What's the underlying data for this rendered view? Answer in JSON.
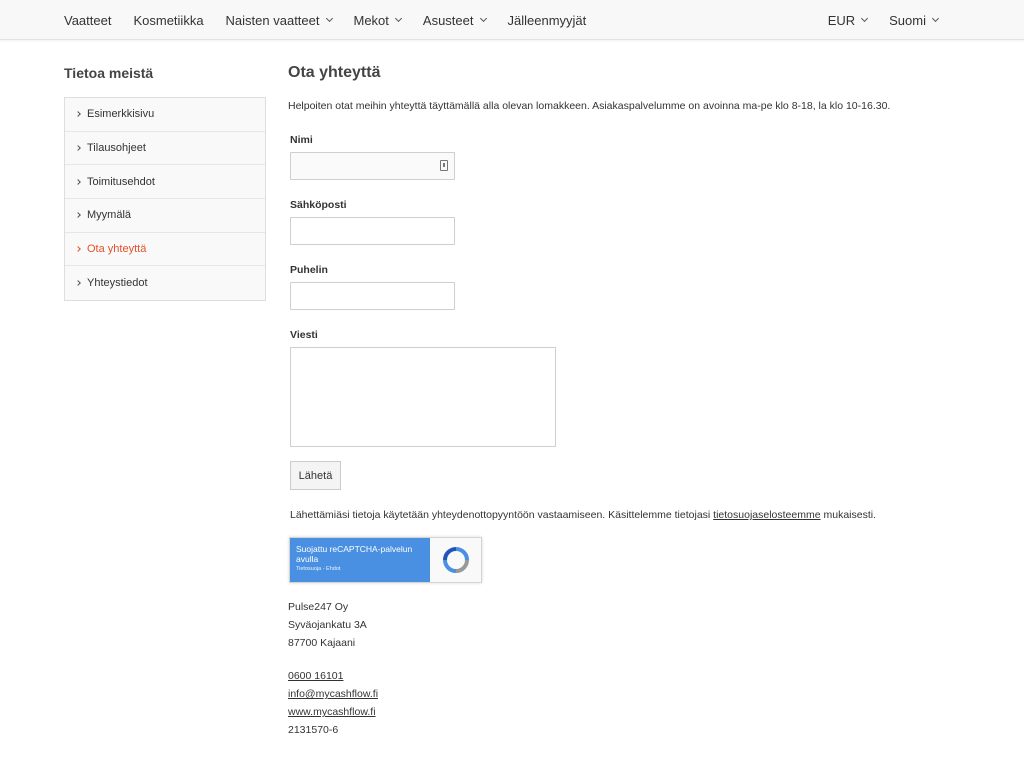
{
  "nav": {
    "left": [
      {
        "label": "Vaatteet",
        "dropdown": false
      },
      {
        "label": "Kosmetiikka",
        "dropdown": false
      },
      {
        "label": "Naisten vaatteet",
        "dropdown": true
      },
      {
        "label": "Mekot",
        "dropdown": true
      },
      {
        "label": "Asusteet",
        "dropdown": true
      },
      {
        "label": "Jälleenmyyjät",
        "dropdown": false
      }
    ],
    "currency": "EUR",
    "language": "Suomi"
  },
  "sidebar": {
    "title": "Tietoa meistä",
    "items": [
      {
        "label": "Esimerkkisivu",
        "active": false
      },
      {
        "label": "Tilausohjeet",
        "active": false
      },
      {
        "label": "Toimitusehdot",
        "active": false
      },
      {
        "label": "Myymälä",
        "active": false
      },
      {
        "label": "Ota yhteyttä",
        "active": true
      },
      {
        "label": "Yhteystiedot",
        "active": false
      }
    ]
  },
  "main": {
    "title": "Ota yhteyttä",
    "intro": "Helpoiten otat meihin yhteyttä täyttämällä alla olevan lomakkeen. Asiakaspalvelumme on avoinna ma-pe klo 8-18, la klo 10-16.30.",
    "form": {
      "name_label": "Nimi",
      "name_value": "",
      "email_label": "Sähköposti",
      "email_value": "",
      "phone_label": "Puhelin",
      "phone_value": "",
      "message_label": "Viesti",
      "message_value": "",
      "submit_label": "Lähetä"
    },
    "privacy": {
      "before": "Lähettämiäsi tietoja käytetään yhteydenottopyyntöön vastaamiseen. Käsittelemme tietojasi ",
      "link": "tietosuojaselosteemme",
      "after": " mukaisesti."
    },
    "recaptcha": {
      "text": "Suojattu reCAPTCHA-palvelun avulla",
      "small": "Tietosuoja - Ehdot"
    },
    "contact": {
      "company": "Pulse247 Oy",
      "street": "Syväojankatu 3A",
      "city": "87700 Kajaani",
      "phone": "0600 16101",
      "email": "info@mycashflow.fi",
      "web": "www.mycashflow.fi",
      "business_id": "2131570-6"
    }
  },
  "colors": {
    "accent": "#e0522b",
    "recaptcha_blue": "#4a90e2"
  }
}
